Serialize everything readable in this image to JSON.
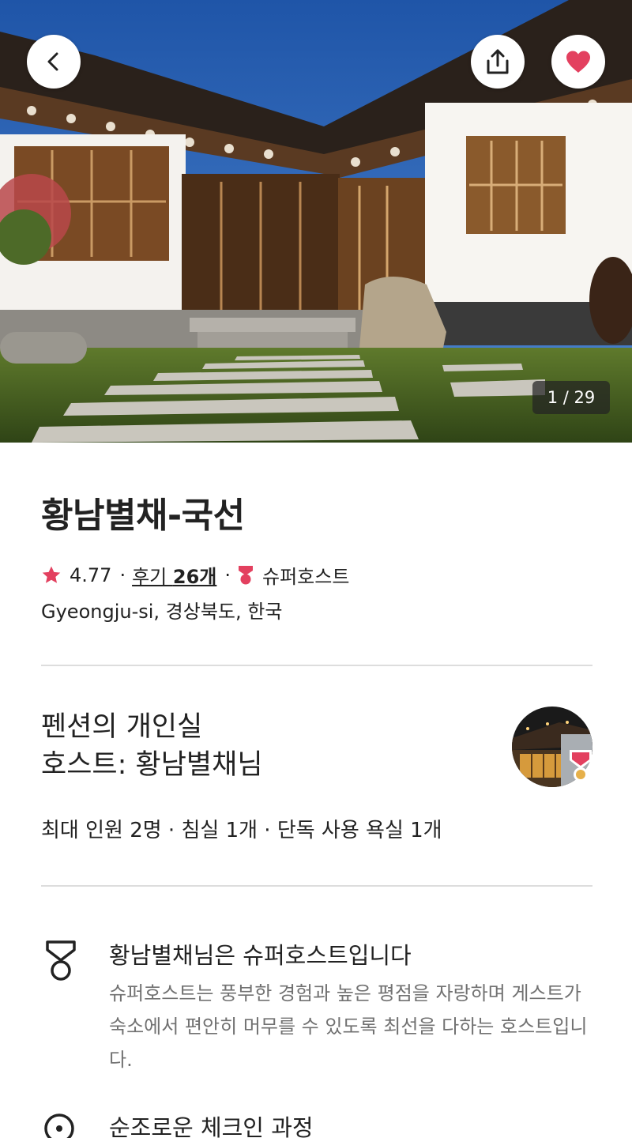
{
  "photo": {
    "counter": "1 / 29",
    "back_icon": "chevron-left-icon",
    "share_icon": "share-icon",
    "favorite_icon": "heart-icon",
    "favorite_color": "#e3405f"
  },
  "listing": {
    "title": "황남별채-국선",
    "rating": "4.77",
    "separator": "·",
    "reviews_prefix": "후기 ",
    "reviews_count": "26개",
    "superhost_label": "슈퍼호스트",
    "location": "Gyeongju-si, 경상북도, 한국"
  },
  "host": {
    "room_type": "펜션의 개인실",
    "host_line": "호스트: 황남별채님",
    "capacity": "최대 인원 2명 · 침실 1개 · 단독 사용 욕실 1개"
  },
  "features": [
    {
      "icon": "superhost-medal-icon",
      "title": "황남별채님은 슈퍼호스트입니다",
      "description": "슈퍼호스트는 풍부한 경험과 높은 평점을 자랑하며 게스트가 숙소에서 편안히 머무를 수 있도록 최선을 다하는 호스트입니다."
    },
    {
      "icon": "checkin-icon",
      "title": "순조로운 체크인 과정",
      "description": ""
    }
  ],
  "colors": {
    "accent": "#e3405f",
    "text": "#222222",
    "muted": "#717171",
    "divider": "#dddddd"
  }
}
